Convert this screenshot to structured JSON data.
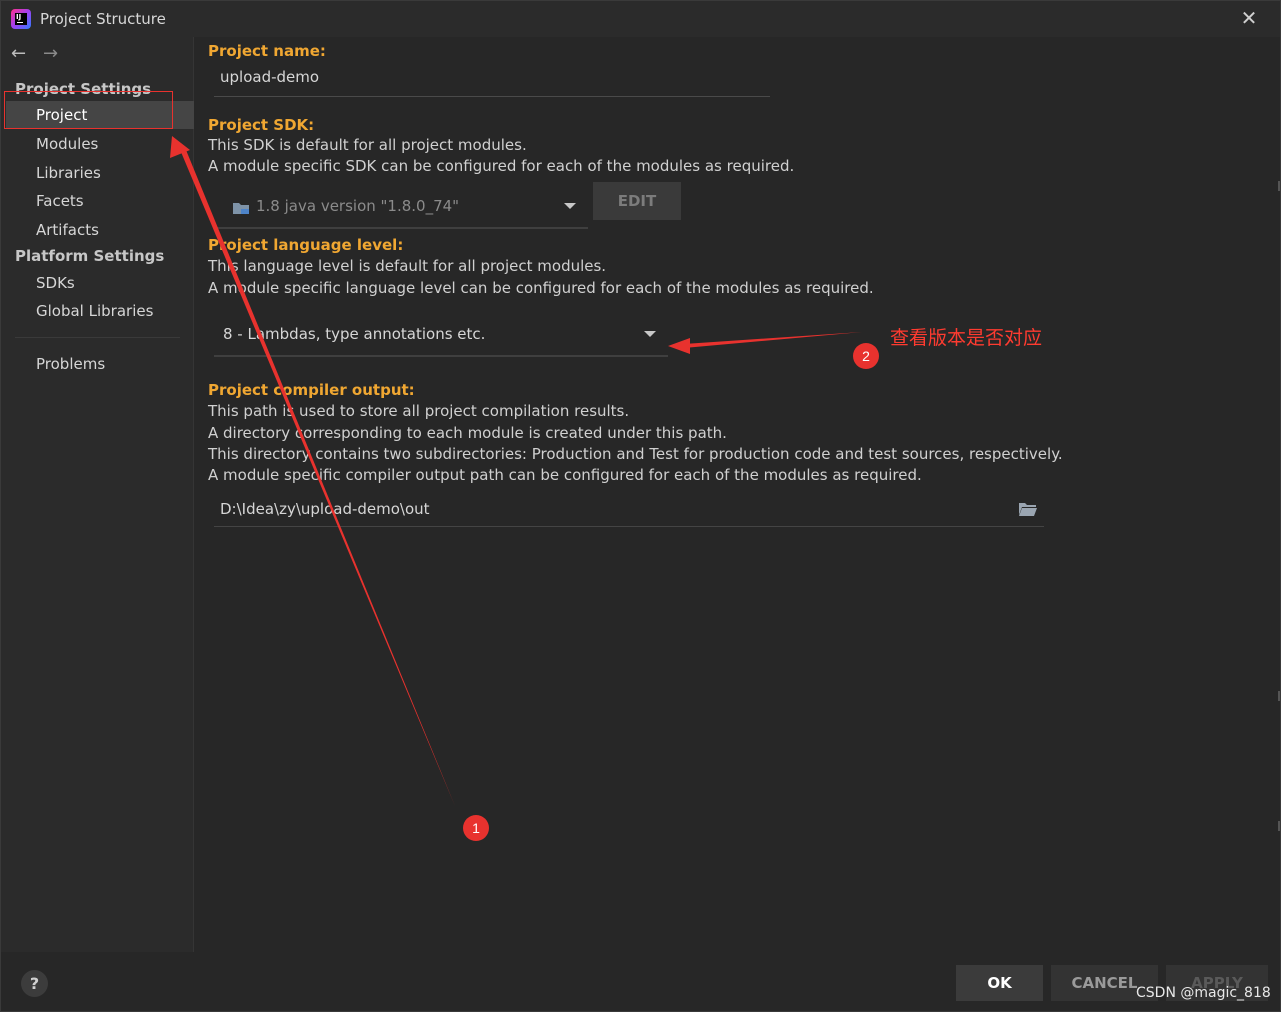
{
  "window": {
    "title": "Project Structure",
    "close_label": "✕"
  },
  "nav": {
    "back": "←",
    "forward": "→"
  },
  "sidebar": {
    "project_settings_header": "Project Settings",
    "project_items": [
      {
        "label": "Project"
      },
      {
        "label": "Modules"
      },
      {
        "label": "Libraries"
      },
      {
        "label": "Facets"
      },
      {
        "label": "Artifacts"
      }
    ],
    "platform_settings_header": "Platform Settings",
    "platform_items": [
      {
        "label": "SDKs"
      },
      {
        "label": "Global Libraries"
      }
    ],
    "problems": "Problems",
    "selected": "Project"
  },
  "project_name": {
    "label": "Project name:",
    "value": "upload-demo"
  },
  "project_sdk": {
    "label": "Project SDK:",
    "desc1": "This SDK is default for all project modules.",
    "desc2": "A module specific SDK can be configured for each of the modules as required.",
    "value": "1.8 java version \"1.8.0_74\"",
    "edit_label": "EDIT"
  },
  "language_level": {
    "label": "Project language level:",
    "desc1": "This language level is default for all project modules.",
    "desc2": "A module specific language level can be configured for each of the modules as required.",
    "value": "8 - Lambdas, type annotations etc."
  },
  "compiler_output": {
    "label": "Project compiler output:",
    "desc1": "This path is used to store all project compilation results.",
    "desc2": "A directory corresponding to each module is created under this path.",
    "desc3": "This directory contains two subdirectories: Production and Test for production code and test sources, respectively.",
    "desc4": "A module specific compiler output path can be configured for each of the modules as required.",
    "path": "D:\\Idea\\zy\\upload-demo\\out"
  },
  "footer": {
    "help": "?",
    "ok": "OK",
    "cancel": "CANCEL",
    "apply": "APPLY"
  },
  "annotations": {
    "badge1": "1",
    "badge2": "2",
    "note": "查看版本是否对应",
    "color": "#e8322e"
  },
  "watermark": "CSDN @magic_818",
  "colors": {
    "label_orange": "#f0a732",
    "background": "#272727",
    "sidebar_selected": "#454545"
  }
}
